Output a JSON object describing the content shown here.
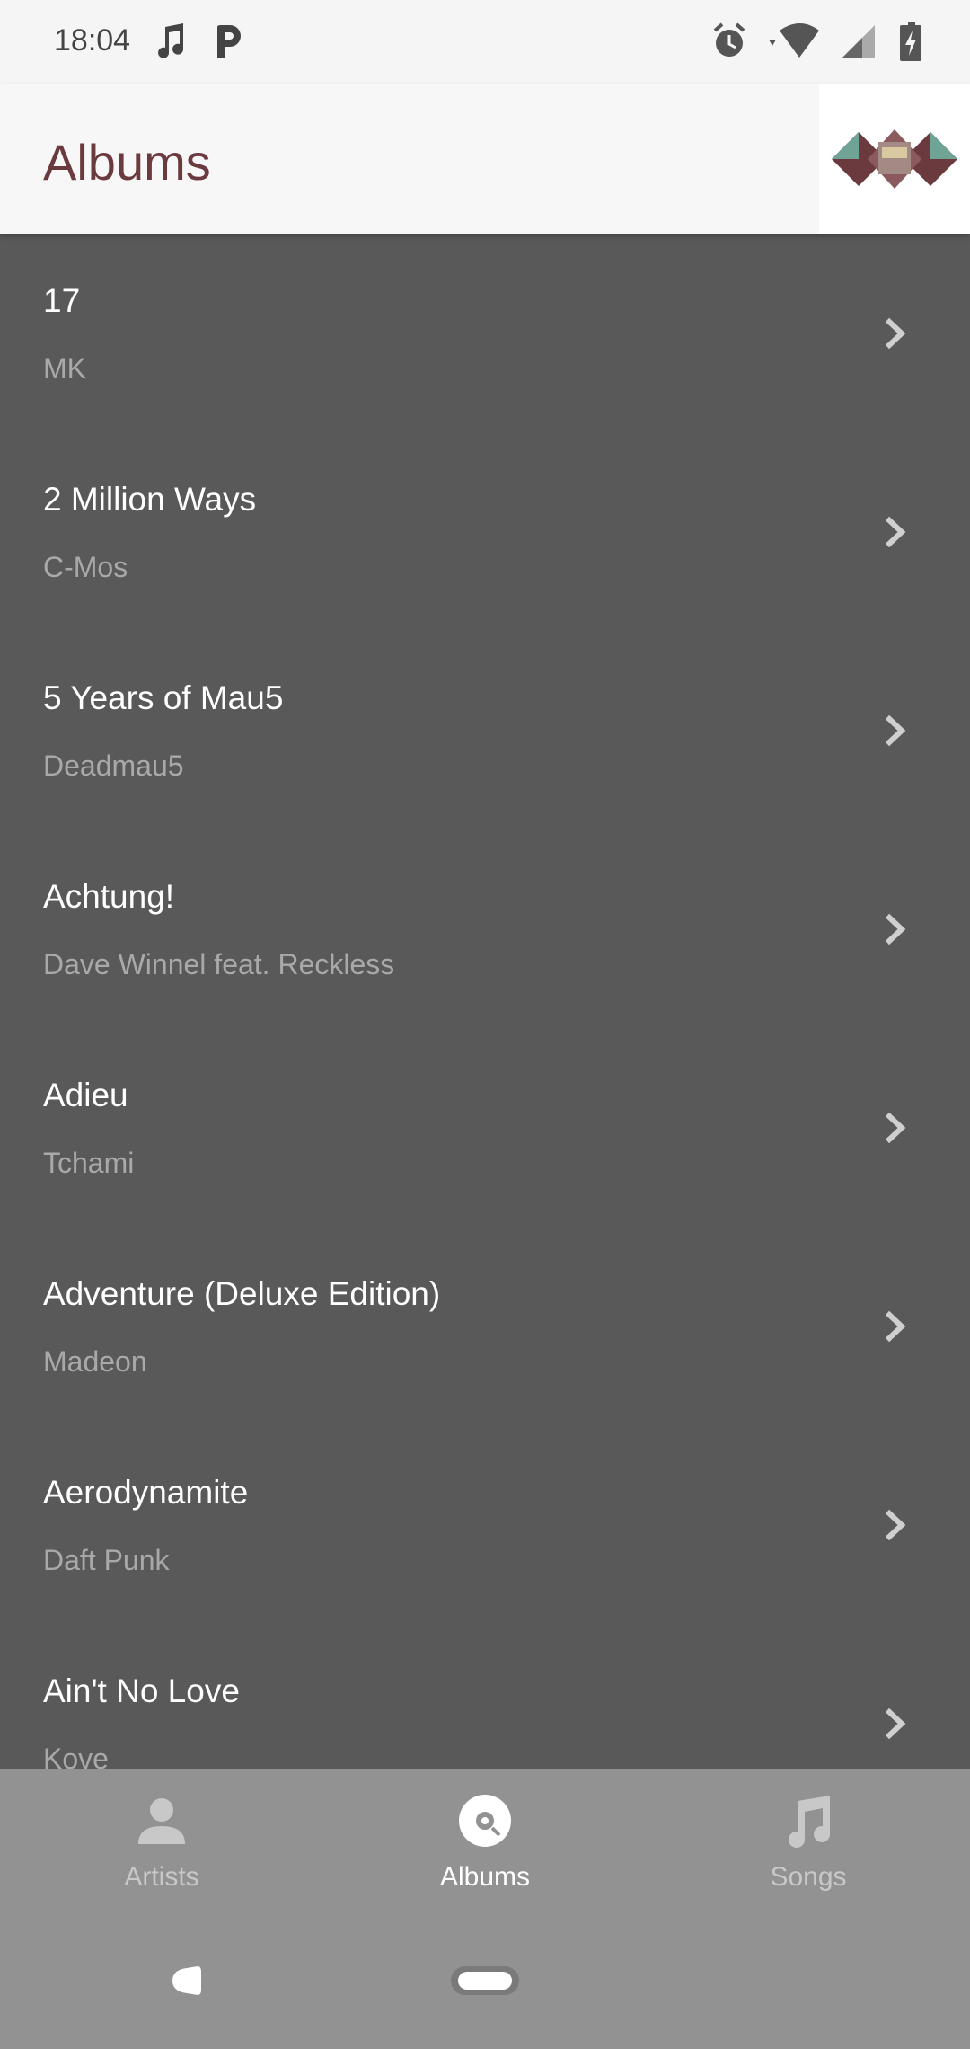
{
  "status_bar": {
    "time": "18:04",
    "icons": [
      "music-note-icon",
      "parking-icon",
      "alarm-icon",
      "wifi-icon",
      "signal-icon",
      "battery-charging-icon"
    ]
  },
  "app_bar": {
    "title": "Albums",
    "album_art": "album-artwork"
  },
  "albums": [
    {
      "title": "17",
      "artist": "MK"
    },
    {
      "title": "2 Million Ways",
      "artist": "C-Mos"
    },
    {
      "title": "5 Years of Mau5",
      "artist": "Deadmau5"
    },
    {
      "title": "Achtung!",
      "artist": "Dave Winnel feat. Reckless"
    },
    {
      "title": "Adieu",
      "artist": "Tchami"
    },
    {
      "title": "Adventure (Deluxe Edition)",
      "artist": "Madeon"
    },
    {
      "title": "Aerodynamite",
      "artist": "Daft Punk"
    },
    {
      "title": "Ain't No Love",
      "artist": "Kove"
    }
  ],
  "bottom_nav": {
    "tabs": [
      {
        "label": "Artists",
        "icon": "person-icon",
        "active": false
      },
      {
        "label": "Albums",
        "icon": "disc-icon",
        "active": true
      },
      {
        "label": "Songs",
        "icon": "music-note-icon",
        "active": false
      }
    ]
  },
  "colors": {
    "list_background": "#595959",
    "title_color": "#6b3a3f",
    "nav_background": "#929292",
    "active_tab": "#ffffff",
    "inactive_tab": "#c8c8c8"
  }
}
